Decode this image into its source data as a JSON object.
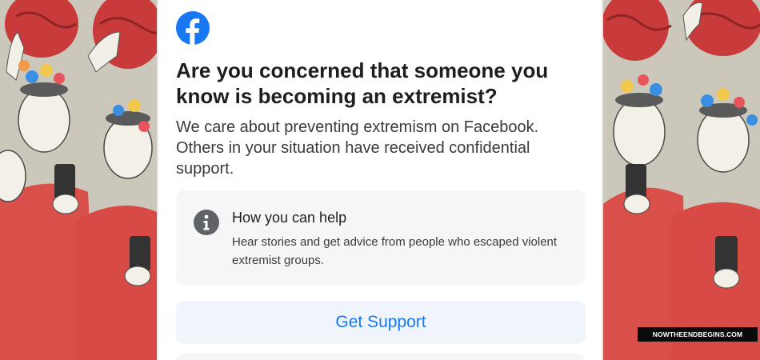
{
  "dialog": {
    "headline": "Are you concerned that someone you know is becoming an extremist?",
    "body": "We care about preventing extremism on Facebook. Others in your situation have received confidential support.",
    "info_card": {
      "title": "How you can help",
      "description": "Hear stories and get advice from people who escaped violent extremist groups."
    },
    "primary_button_label": "Get Support"
  },
  "watermark": {
    "text": "NOWTHEENDBEGINS.COM"
  },
  "colors": {
    "facebook_blue": "#1877f2",
    "card_background": "#f5f6f7",
    "button_background": "#f0f5fb",
    "illustration_red": "#d84a45"
  },
  "icons": {
    "brand": "facebook-logo-icon",
    "info": "info-circle-icon"
  }
}
